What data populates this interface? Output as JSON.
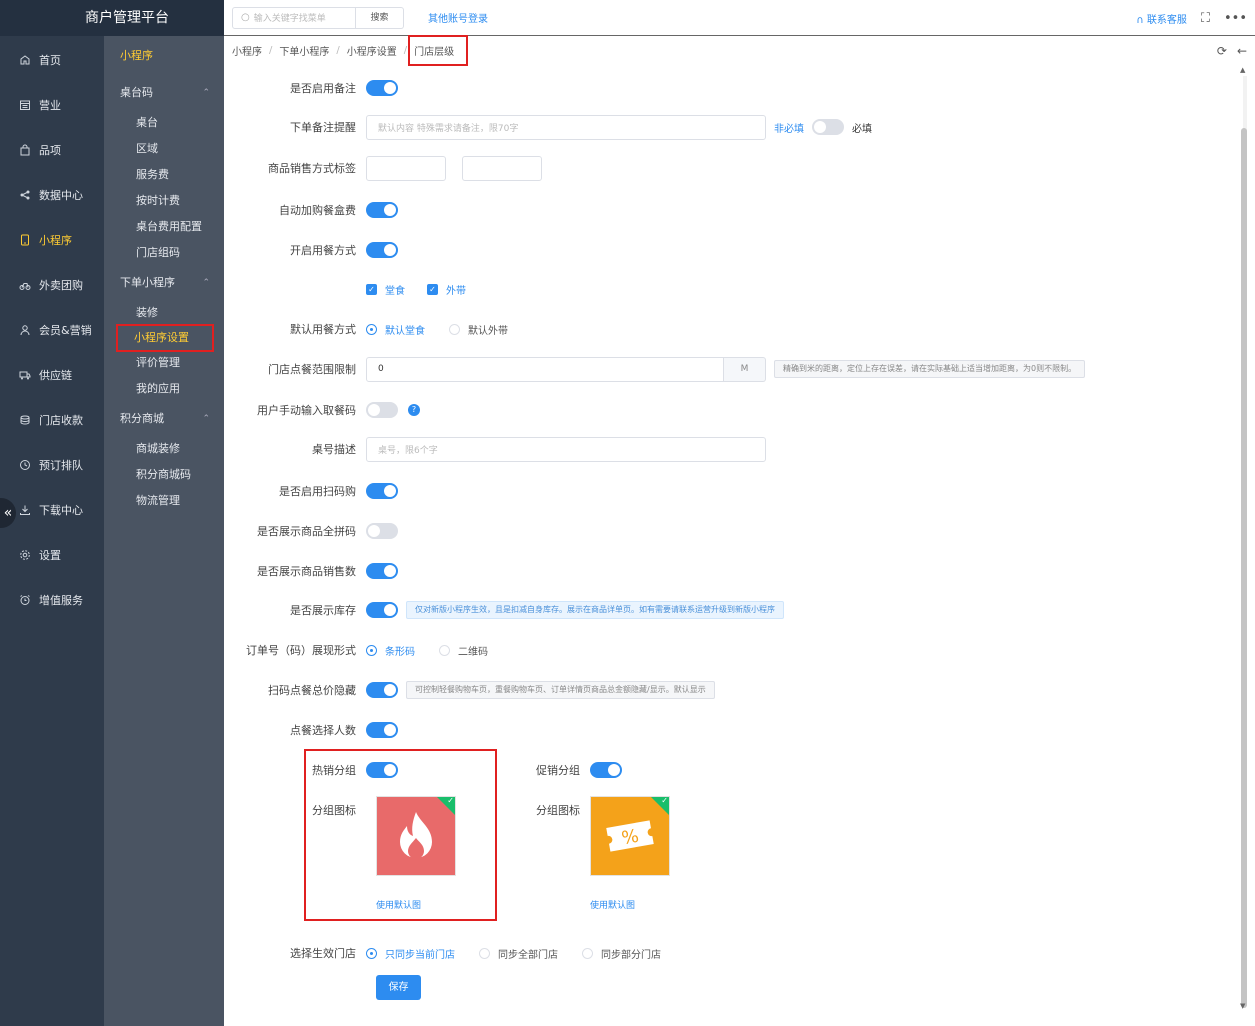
{
  "app": {
    "title": "商户管理平台"
  },
  "nav": [
    {
      "label": "首页",
      "icon": "home-icon"
    },
    {
      "label": "营业",
      "icon": "calendar-icon"
    },
    {
      "label": "品项",
      "icon": "bag-icon"
    },
    {
      "label": "数据中心",
      "icon": "share-icon"
    },
    {
      "label": "小程序",
      "icon": "miniapp-icon"
    },
    {
      "label": "外卖团购",
      "icon": "bike-icon"
    },
    {
      "label": "会员&营销",
      "icon": "user-icon"
    },
    {
      "label": "供应链",
      "icon": "truck-icon"
    },
    {
      "label": "门店收款",
      "icon": "coins-icon"
    },
    {
      "label": "预订排队",
      "icon": "clock-icon"
    },
    {
      "label": "下载中心",
      "icon": "download-icon"
    },
    {
      "label": "设置",
      "icon": "gear-icon"
    },
    {
      "label": "增值服务",
      "icon": "alarm-icon"
    }
  ],
  "subnav": {
    "title": "小程序",
    "groups": [
      {
        "label": "桌台码",
        "items": [
          "桌台",
          "区域",
          "服务费",
          "按时计费",
          "桌台费用配置",
          "门店组码"
        ]
      },
      {
        "label": "下单小程序",
        "items": [
          "装修",
          "小程序设置",
          "评价管理",
          "我的应用"
        ]
      },
      {
        "label": "积分商城",
        "items": [
          "商城装修",
          "积分商城码",
          "物流管理"
        ]
      }
    ]
  },
  "topbar": {
    "search_placeholder": "输入关键字找菜单",
    "search_button": "搜索",
    "other_login": "其他账号登录",
    "service": "联系客服"
  },
  "breadcrumb": [
    "小程序",
    "下单小程序",
    "小程序设置",
    "门店层级"
  ],
  "form": {
    "enable_remark": {
      "label": "是否启用备注"
    },
    "remark_hint": {
      "label": "下单备注提醒",
      "placeholder": "默认内容 特殊需求请备注，限70字",
      "optional": "非必填",
      "required": "必填"
    },
    "sale_tag": {
      "label": "商品销售方式标签"
    },
    "auto_box_fee": {
      "label": "自动加购餐盒费"
    },
    "dining_mode": {
      "label": "开启用餐方式",
      "options": [
        "堂食",
        "外带"
      ]
    },
    "default_mode": {
      "label": "默认用餐方式",
      "options": [
        "默认堂食",
        "默认外带"
      ]
    },
    "range_limit": {
      "label": "门店点餐范围限制",
      "value": "0",
      "unit": "M",
      "tip": "精确到米的距离，定位上存在误差，请在实际基础上适当增加距离，为0则不限制。"
    },
    "manual_code": {
      "label": "用户手动输入取餐码",
      "help": "?"
    },
    "table_desc": {
      "label": "桌号描述",
      "placeholder": "桌号，限6个字"
    },
    "scan_buy": {
      "label": "是否启用扫码购"
    },
    "pinyin": {
      "label": "是否展示商品全拼码"
    },
    "sales_count": {
      "label": "是否展示商品销售数"
    },
    "stock": {
      "label": "是否展示库存",
      "tip": "仅对新版小程序生效，且是扣减自身库存。展示在商品详单页。如有需要请联系运营升级到新版小程序"
    },
    "order_code": {
      "label": "订单号（码）展现形式",
      "options": [
        "条形码",
        "二维码"
      ]
    },
    "hide_total": {
      "label": "扫码点餐总价隐藏",
      "tip": "可控制轻餐购物车页，重餐购物车页、订单详情页商品总金额隐藏/显示。默认显示"
    },
    "choose_people": {
      "label": "点餐选择人数"
    },
    "hot_group": {
      "label": "热销分组",
      "icon_label": "分组图标",
      "default": "使用默认图"
    },
    "promo_group": {
      "label": "促销分组",
      "icon_label": "分组图标",
      "default": "使用默认图"
    },
    "store_scope": {
      "label": "选择生效门店",
      "options": [
        "只同步当前门店",
        "同步全部门店",
        "同步部分门店"
      ]
    },
    "save": "保存"
  },
  "colors": {
    "accent": "#2d8cf0",
    "nav_bg": "#2f3b4b",
    "subnav_bg": "#4a5462",
    "highlight": "#ffcc33",
    "hot_icon": "#e86a6a",
    "promo_icon": "#f4a21a",
    "annotation": "#e02020"
  }
}
